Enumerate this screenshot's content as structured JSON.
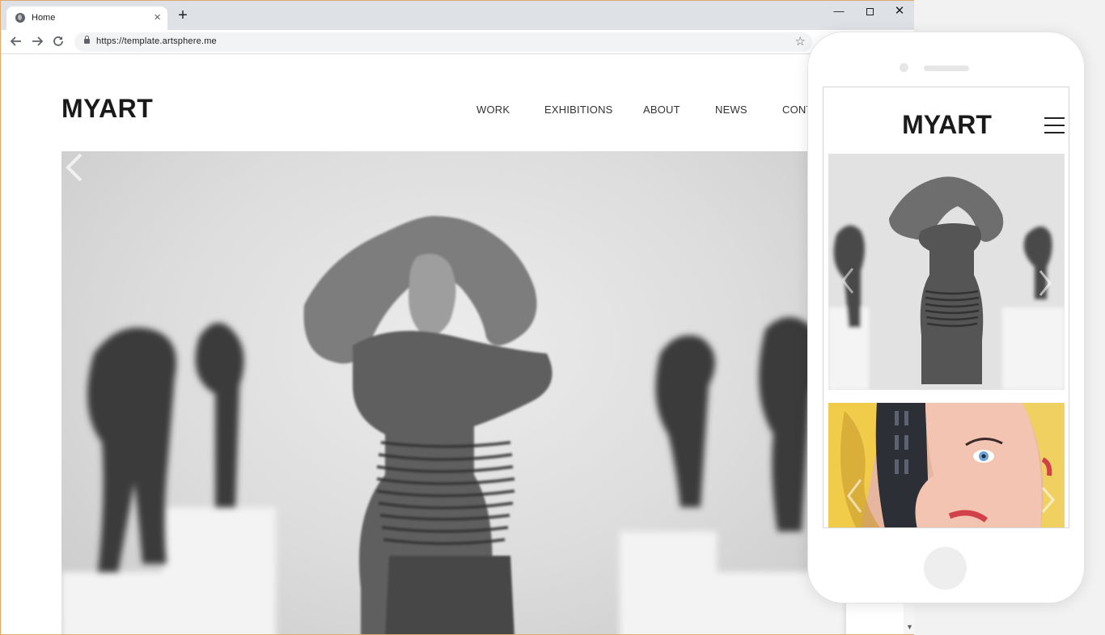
{
  "browser": {
    "tab_title": "Home",
    "tab_close": "×",
    "new_tab": "+",
    "url": "https://template.artsphere.me",
    "window_controls": {
      "minimize": "—",
      "close": "✕"
    }
  },
  "site": {
    "logo": "MYART",
    "nav": [
      "WORK",
      "EXHIBITIONS",
      "ABOUT",
      "NEWS",
      "CONT"
    ]
  },
  "phone": {
    "logo": "MYART"
  },
  "icons": {
    "favicon": "globe-icon",
    "back": "arrow-left-icon",
    "forward": "arrow-right-icon",
    "reload": "reload-icon",
    "lock": "lock-icon",
    "bookmark": "star-icon",
    "menu": "hamburger-icon"
  },
  "colors": {
    "window_border": "#e0a96d",
    "tabstrip": "#dee1e6",
    "logo_text": "#1a1a1a"
  }
}
